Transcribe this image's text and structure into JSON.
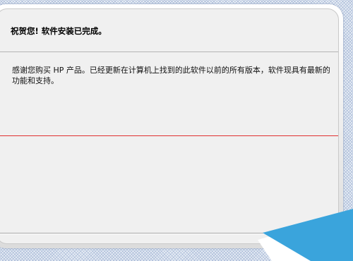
{
  "dialog": {
    "title": "祝贺您! 软件安装已完成。",
    "message": "感谢您购买 HP 产品。已经更新在计算机上找到的此软件以前的所有版本，软件现具有最新的功能和支持。"
  },
  "colors": {
    "accent_corner": "#3aa4dc",
    "separator_red": "#e03030"
  }
}
